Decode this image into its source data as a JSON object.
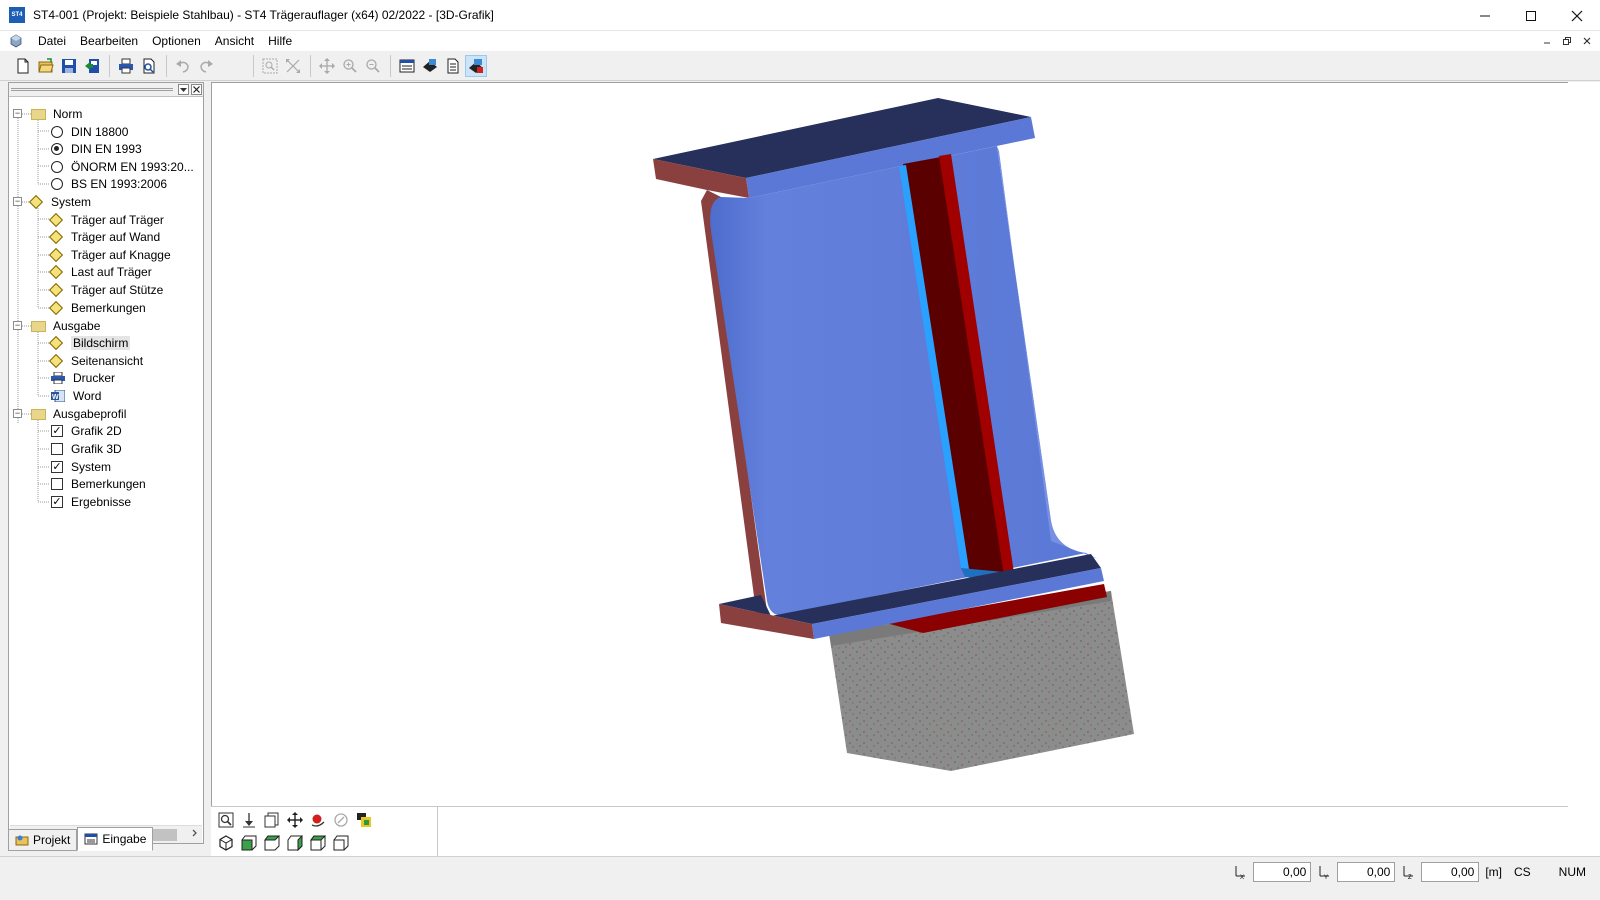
{
  "window": {
    "title": "ST4-001 (Projekt: Beispiele Stahlbau) - ST4 Trägerauflager (x64) 02/2022 - [3D-Grafik]",
    "app_icon_text": "ST4",
    "controls": [
      "minimize-icon",
      "maximize-icon",
      "close-icon"
    ]
  },
  "menu": {
    "items": [
      "Datei",
      "Bearbeiten",
      "Optionen",
      "Ansicht",
      "Hilfe"
    ]
  },
  "toolbar": {
    "icons": [
      "new-file-icon",
      "open-folder-icon",
      "save-icon",
      "export-icon",
      "print-icon",
      "print-preview-icon",
      "undo-icon",
      "redo-icon",
      "zoom-window-icon",
      "zoom-all-icon",
      "pan-icon",
      "zoom-in-icon",
      "zoom-out-icon",
      "calc-table-icon",
      "output-icon",
      "document-icon",
      "3d-view-icon"
    ]
  },
  "tree": {
    "groups": [
      {
        "label": "Norm",
        "items": [
          {
            "label": "DIN 18800",
            "type": "radio",
            "checked": false
          },
          {
            "label": "DIN EN 1993",
            "type": "radio",
            "checked": true
          },
          {
            "label": "ÖNORM EN 1993:20...",
            "type": "radio",
            "checked": false
          },
          {
            "label": "BS EN 1993:2006",
            "type": "radio",
            "checked": false
          }
        ]
      },
      {
        "label": "System",
        "items": [
          {
            "label": "Träger auf Träger",
            "type": "diamond"
          },
          {
            "label": "Träger auf Wand",
            "type": "diamond"
          },
          {
            "label": "Träger auf Knagge",
            "type": "diamond"
          },
          {
            "label": "Last auf Träger",
            "type": "diamond"
          },
          {
            "label": "Träger auf Stütze",
            "type": "diamond"
          },
          {
            "label": "Bemerkungen",
            "type": "diamond"
          }
        ]
      },
      {
        "label": "Ausgabe",
        "items": [
          {
            "label": "Bildschirm",
            "type": "diamond",
            "selected": true
          },
          {
            "label": "Seitenansicht",
            "type": "diamond"
          },
          {
            "label": "Drucker",
            "type": "printer-icon"
          },
          {
            "label": "Word",
            "type": "word-icon"
          }
        ]
      },
      {
        "label": "Ausgabeprofil",
        "items": [
          {
            "label": "Grafik 2D",
            "type": "checkbox",
            "checked": true
          },
          {
            "label": "Grafik 3D",
            "type": "checkbox",
            "checked": false
          },
          {
            "label": "System",
            "type": "checkbox",
            "checked": true
          },
          {
            "label": "Bemerkungen",
            "type": "checkbox",
            "checked": false
          },
          {
            "label": "Ergebnisse",
            "type": "checkbox",
            "checked": true
          }
        ]
      }
    ]
  },
  "tabs": [
    {
      "label": "Projekt",
      "active": false
    },
    {
      "label": "Eingabe",
      "active": true
    }
  ],
  "status": {
    "x_value": "0,00",
    "y_value": "0,00",
    "z_value": "0,00",
    "unit": "[m]",
    "cs": "CS",
    "num": "NUM"
  },
  "colors": {
    "flange_top": "#26305a",
    "flange_blue": "#5b78d6",
    "flange_red": "#8b4040",
    "stiffener": "#8b0000",
    "concrete": "#8c8c8c"
  }
}
